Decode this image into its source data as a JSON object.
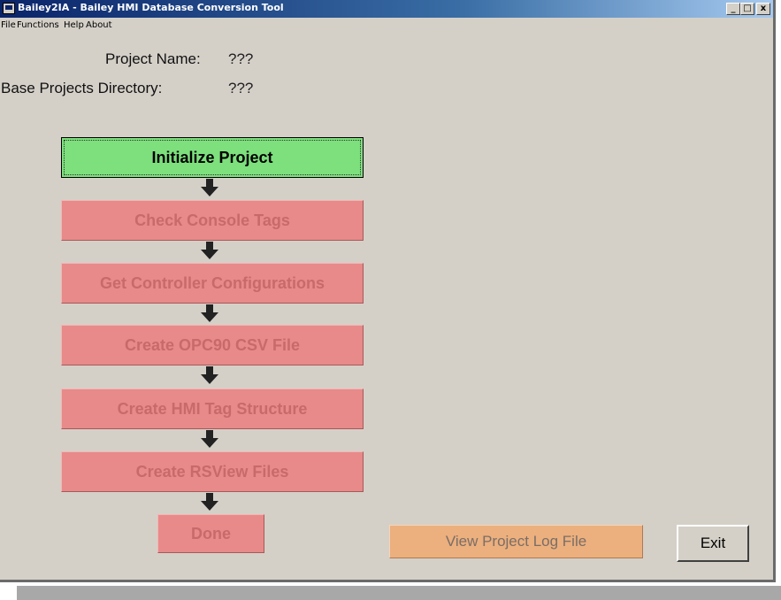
{
  "window": {
    "title": "Bailey2IA  -  Bailey HMI Database Conversion Tool",
    "controls": {
      "minimize": "_",
      "maximize": "□",
      "close": "x"
    }
  },
  "menu": [
    "File",
    "Functions",
    "Help",
    "About"
  ],
  "project": {
    "name_label": "Project Name:",
    "name_value": "???",
    "dir_label": "Base Projects Directory:",
    "dir_value": "???"
  },
  "steps": [
    {
      "label": "Initialize Project",
      "state": "active"
    },
    {
      "label": "Check Console Tags",
      "state": "disabled"
    },
    {
      "label": "Get Controller Configurations",
      "state": "disabled"
    },
    {
      "label": "Create OPC90 CSV File",
      "state": "disabled"
    },
    {
      "label": "Create HMI Tag Structure",
      "state": "disabled"
    },
    {
      "label": "Create RSView Files",
      "state": "disabled"
    },
    {
      "label": "Done",
      "state": "disabled"
    }
  ],
  "buttons": {
    "view_log": "View Project Log File",
    "exit": "Exit"
  },
  "colors": {
    "active_step": "#7de07d",
    "disabled_step": "#e88a8a",
    "log_button": "#ecaf7e",
    "window_bg": "#d4d0c8"
  }
}
